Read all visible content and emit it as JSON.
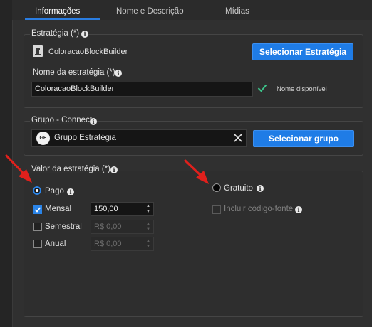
{
  "tabs": [
    {
      "label": "Informações"
    },
    {
      "label": "Nome e Descrição"
    },
    {
      "label": "Mídias"
    }
  ],
  "strategy": {
    "label": "Estratégia (*)",
    "selected": "ColoracaoBlockBuilder",
    "select_button": "Selecionar Estratégia"
  },
  "strategy_name": {
    "label": "Nome da estratégia (*)",
    "value": "ColoracaoBlockBuilder",
    "status": "Nome disponível"
  },
  "group": {
    "label": "Grupo - Connect",
    "avatar_text": "GE",
    "value": "Grupo Estratégia",
    "select_button": "Selecionar grupo"
  },
  "pricing": {
    "label": "Valor da estratégia (*)",
    "paid_label": "Pago",
    "free_label": "Gratuito",
    "include_source_label": "Incluir código-fonte",
    "plans": [
      {
        "label": "Mensal",
        "value": "150,00",
        "checked": true
      },
      {
        "label": "Semestral",
        "value": "R$ 0,00",
        "checked": false
      },
      {
        "label": "Anual",
        "value": "R$ 0,00",
        "checked": false
      }
    ]
  },
  "colors": {
    "accent": "#1f7ce6",
    "check_green": "#3cc48a",
    "annotation_arrow": "#e0201c"
  }
}
